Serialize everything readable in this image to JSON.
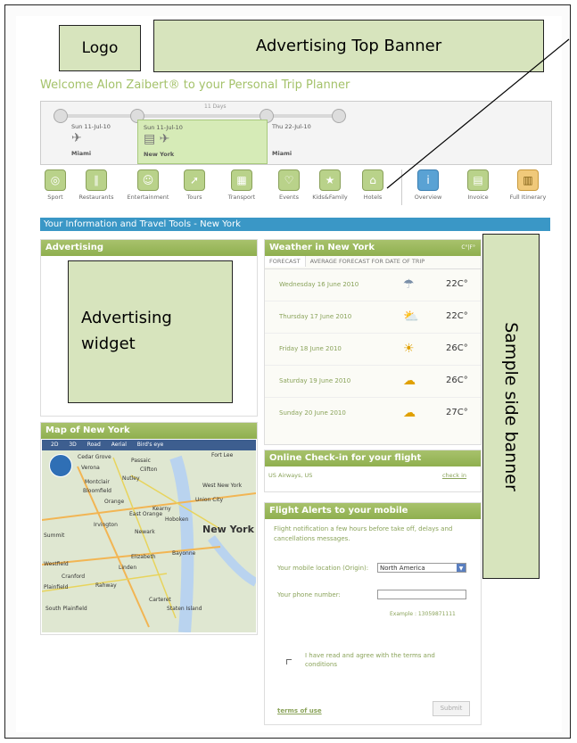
{
  "mockup": {
    "logo": "Logo",
    "top_banner": "Advertising Top Banner",
    "ad_widget": "Advertising widget",
    "side_banner": "Sample side banner"
  },
  "welcome": "Welcome Alon Zaibert® to your Personal Trip Planner",
  "timeline": {
    "days_label": "11 Days",
    "segments": [
      {
        "date": "Sun 11-Jul-10",
        "city": "Miami",
        "icon": "✈"
      },
      {
        "date": "Sun 11-Jul-10",
        "city": "New York",
        "icon": "▤ ✈"
      },
      {
        "date": "Thu 22-Jul-10",
        "city": "Miami",
        "icon": ""
      }
    ]
  },
  "nav": [
    {
      "label": "Sport",
      "icon": "◎"
    },
    {
      "label": "Restaurants",
      "icon": "∥"
    },
    {
      "label": "Entertainment",
      "icon": "☺"
    },
    {
      "label": "Tours",
      "icon": "➚"
    },
    {
      "label": "Transport",
      "icon": "▦"
    },
    {
      "label": "Events",
      "icon": "♡"
    },
    {
      "label": "Kids&Family",
      "icon": "★"
    },
    {
      "label": "Hotels",
      "icon": "⌂"
    },
    {
      "label": "Overview",
      "icon": "i"
    },
    {
      "label": "Invoice",
      "icon": "▤"
    },
    {
      "label": "Full Itinerary",
      "icon": "▥"
    }
  ],
  "info_bar": "Your Information and Travel Tools - New York",
  "panels": {
    "advertising_title": "Advertising",
    "map_title": "Map of New York",
    "weather_title": "Weather in New York",
    "weather_units": "C°|F°",
    "checkin_title": "Online Check-in for your flight",
    "alerts_title": "Flight Alerts to your mobile"
  },
  "map": {
    "toolbar": [
      "2D",
      "3D",
      "Road",
      "Aerial",
      "Bird's eye"
    ],
    "labels": [
      "Cedar Grove",
      "Passaic",
      "Verona",
      "Nutley",
      "Clifton",
      "Fort Lee",
      "Montclair",
      "Bloomfield",
      "West New York",
      "Orange",
      "East Orange",
      "Kearny",
      "Hoboken",
      "Union City",
      "New York",
      "Newark",
      "Irvington",
      "Linden",
      "Elizabeth",
      "Bayonne",
      "Cranford",
      "Rahway",
      "Summit",
      "Westfield",
      "Plainfield",
      "South Plainfield",
      "Carteret",
      "Staten Island"
    ]
  },
  "weather": {
    "tabs": [
      "FORECAST",
      "AVERAGE FORECAST FOR DATE OF TRIP"
    ],
    "days": [
      {
        "date": "Wednesday 16 June 2010",
        "temp": "22C°",
        "icon": "rain-icon"
      },
      {
        "date": "Thursday 17 June 2010",
        "temp": "22C°",
        "icon": "sun-cloud-icon"
      },
      {
        "date": "Friday 18 June 2010",
        "temp": "26C°",
        "icon": "sun-icon"
      },
      {
        "date": "Saturday 19 June 2010",
        "temp": "26C°",
        "icon": "cloud-icon"
      },
      {
        "date": "Sunday 20 June 2010",
        "temp": "27C°",
        "icon": "cloud-icon"
      }
    ]
  },
  "checkin": {
    "airline": "US Airways, US",
    "link": "check in"
  },
  "alerts": {
    "description": "Flight notification a few hours before take off, delays and cancellations messages.",
    "location_label": "Your mobile location (Origin):",
    "location_value": "North America",
    "phone_label": "Your phone number:",
    "example": "Example : 13059871111",
    "agree": "I have read and agree with the terms and conditions",
    "terms": "terms of use",
    "submit": "Submit"
  }
}
